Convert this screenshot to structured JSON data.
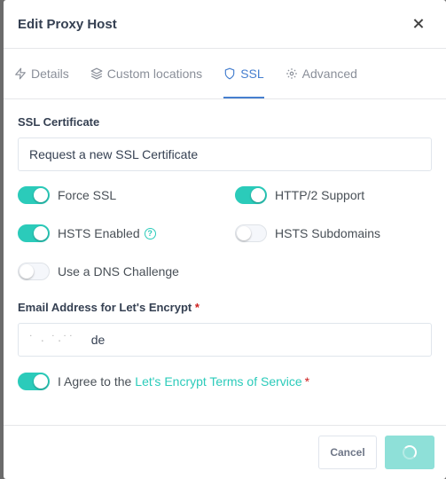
{
  "dialog": {
    "title": "Edit Proxy Host"
  },
  "tabs": [
    {
      "label": "Details",
      "icon": "lightning-icon",
      "active": false
    },
    {
      "label": "Custom locations",
      "icon": "layers-icon",
      "active": false
    },
    {
      "label": "SSL",
      "icon": "shield-icon",
      "active": true
    },
    {
      "label": "Advanced",
      "icon": "gear-icon",
      "active": false
    }
  ],
  "ssl": {
    "certificate_label": "SSL Certificate",
    "certificate_value": "Request a new SSL Certificate",
    "toggles": {
      "force_ssl": {
        "label": "Force SSL",
        "on": true
      },
      "http2": {
        "label": "HTTP/2 Support",
        "on": true
      },
      "hsts": {
        "label": "HSTS Enabled",
        "on": true
      },
      "hsts_subdomains": {
        "label": "HSTS Subdomains",
        "on": false
      },
      "dns_challenge": {
        "label": "Use a DNS Challenge",
        "on": false
      }
    },
    "email_label": "Email Address for Let's Encrypt",
    "required_mark": "*",
    "email_value": "de",
    "agree_prefix": "I Agree to the",
    "agree_link": "Let's Encrypt Terms of Service",
    "agree_on": true
  },
  "footer": {
    "cancel_label": "Cancel"
  },
  "colors": {
    "accent": "#2bcbba",
    "tab_active": "#467fcf"
  }
}
